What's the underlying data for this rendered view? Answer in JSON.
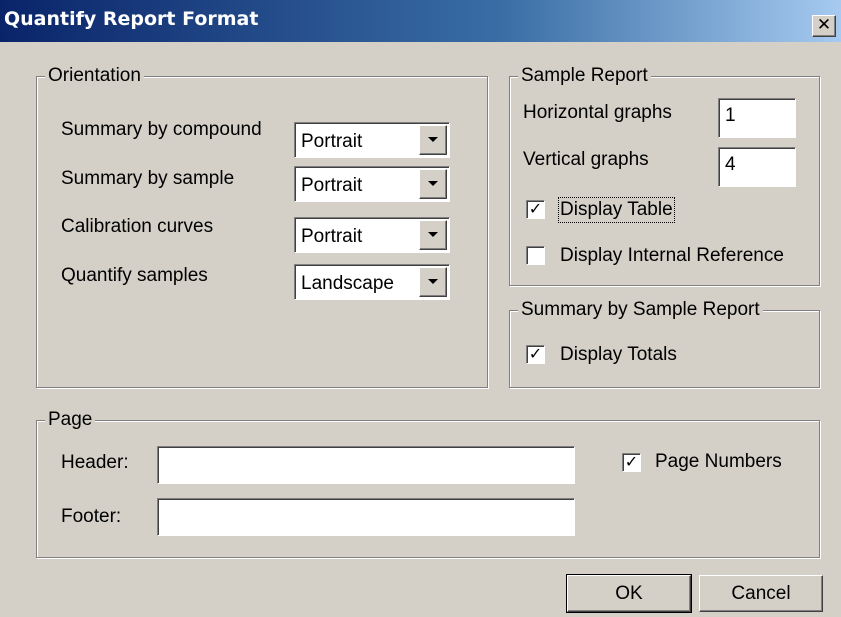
{
  "window": {
    "title": "Quantify Report Format",
    "close_glyph": "✕"
  },
  "orientation": {
    "legend": "Orientation",
    "rows": [
      {
        "label": "Summary by compound",
        "value": "Portrait"
      },
      {
        "label": "Summary by sample",
        "value": "Portrait"
      },
      {
        "label": "Calibration curves",
        "value": "Portrait"
      },
      {
        "label": "Quantify samples",
        "value": "Landscape"
      }
    ]
  },
  "sample_report": {
    "legend": "Sample Report",
    "horizontal_label": "Horizontal graphs",
    "horizontal_value": "1",
    "vertical_label": "Vertical graphs",
    "vertical_value": "4",
    "display_table": {
      "label": "Display Table",
      "checked": true
    },
    "display_internal_reference": {
      "label": "Display Internal Reference",
      "checked": false
    }
  },
  "summary_by_sample_report": {
    "legend": "Summary by Sample Report",
    "display_totals": {
      "label": "Display Totals",
      "checked": true
    }
  },
  "page": {
    "legend": "Page",
    "header_label": "Header:",
    "header_value": "",
    "footer_label": "Footer:",
    "footer_value": "",
    "page_numbers": {
      "label": "Page Numbers",
      "checked": true
    }
  },
  "buttons": {
    "ok": "OK",
    "cancel": "Cancel"
  },
  "colors": {
    "dialog_face": "#d4d0c8",
    "titlebar_start": "#0a246a",
    "titlebar_end": "#a6caf0"
  }
}
